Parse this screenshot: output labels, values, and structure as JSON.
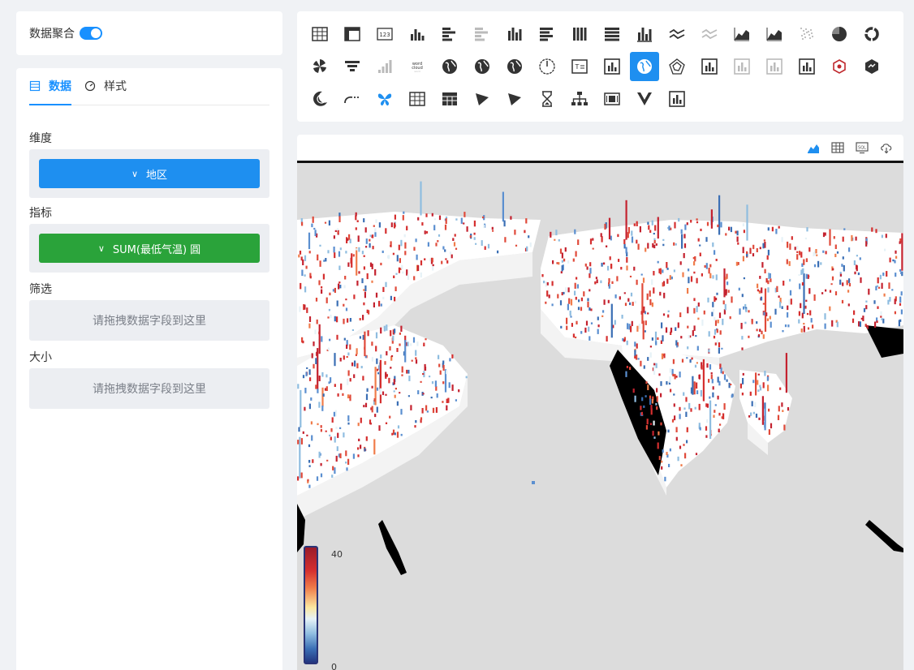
{
  "aggregation": {
    "label": "数据聚合",
    "enabled": true
  },
  "tabs": [
    {
      "label": "数据",
      "icon": "table-icon",
      "active": true
    },
    {
      "label": "样式",
      "icon": "dashboard-icon",
      "active": false
    }
  ],
  "fields": {
    "dimension": {
      "label": "维度",
      "value": "地区"
    },
    "measure": {
      "label": "指标",
      "value": "SUM(最低气温) 圓"
    },
    "filter": {
      "label": "筛选",
      "placeholder": "请拖拽数据字段到这里"
    },
    "size": {
      "label": "大小",
      "placeholder": "请拖拽数据字段到这里"
    }
  },
  "chart_types": [
    "table-icon",
    "pivot-table-icon",
    "kpi-number-icon",
    "bar-chart-icon",
    "horizontal-bar-icon",
    "horizontal-bar-light-icon",
    "column-grouped-icon",
    "horizontal-stacked-icon",
    "column-stacked-100-icon",
    "bar-stacked-100-icon",
    "bar-line-combo-icon",
    "line-icon",
    "line-light-icon",
    "area-icon",
    "area-stacked-icon",
    "scatter-icon",
    "pie-icon",
    "ring-icon",
    "rose-icon",
    "funnel-icon",
    "waterfall-icon",
    "word-cloud-icon",
    "globe-icon",
    "globe-filled-icon",
    "globe-outline-icon",
    "gauge-icon",
    "text-card-icon",
    "custom-chart-icon",
    "3d-globe-icon",
    "radar-icon",
    "custom-chart-icon",
    "custom-chart-light-icon",
    "custom-chart-light-icon",
    "custom-chart-icon",
    "hexagon-map-icon",
    "3d-hexagon-icon",
    "moon-icon",
    "dashed-line-icon",
    "butterfly-icon",
    "grid-table-icon",
    "grid-table-dark-icon",
    "play-triangle-icon",
    "play-triangle-icon",
    "hourglass-icon",
    "org-tree-icon",
    "carousel-icon",
    "v-logo-icon",
    "custom-chart-icon"
  ],
  "active_chart_index": 28,
  "toolbar": [
    "area-chart-icon",
    "table-grid-icon",
    "sql-icon",
    "cloud-download-icon"
  ],
  "legend": {
    "max": "40",
    "min": "0"
  },
  "colors": {
    "primary": "#1e8ff0",
    "measure": "#2aa33a",
    "hot": "#d52f2f",
    "cold": "#3b6fb5"
  }
}
